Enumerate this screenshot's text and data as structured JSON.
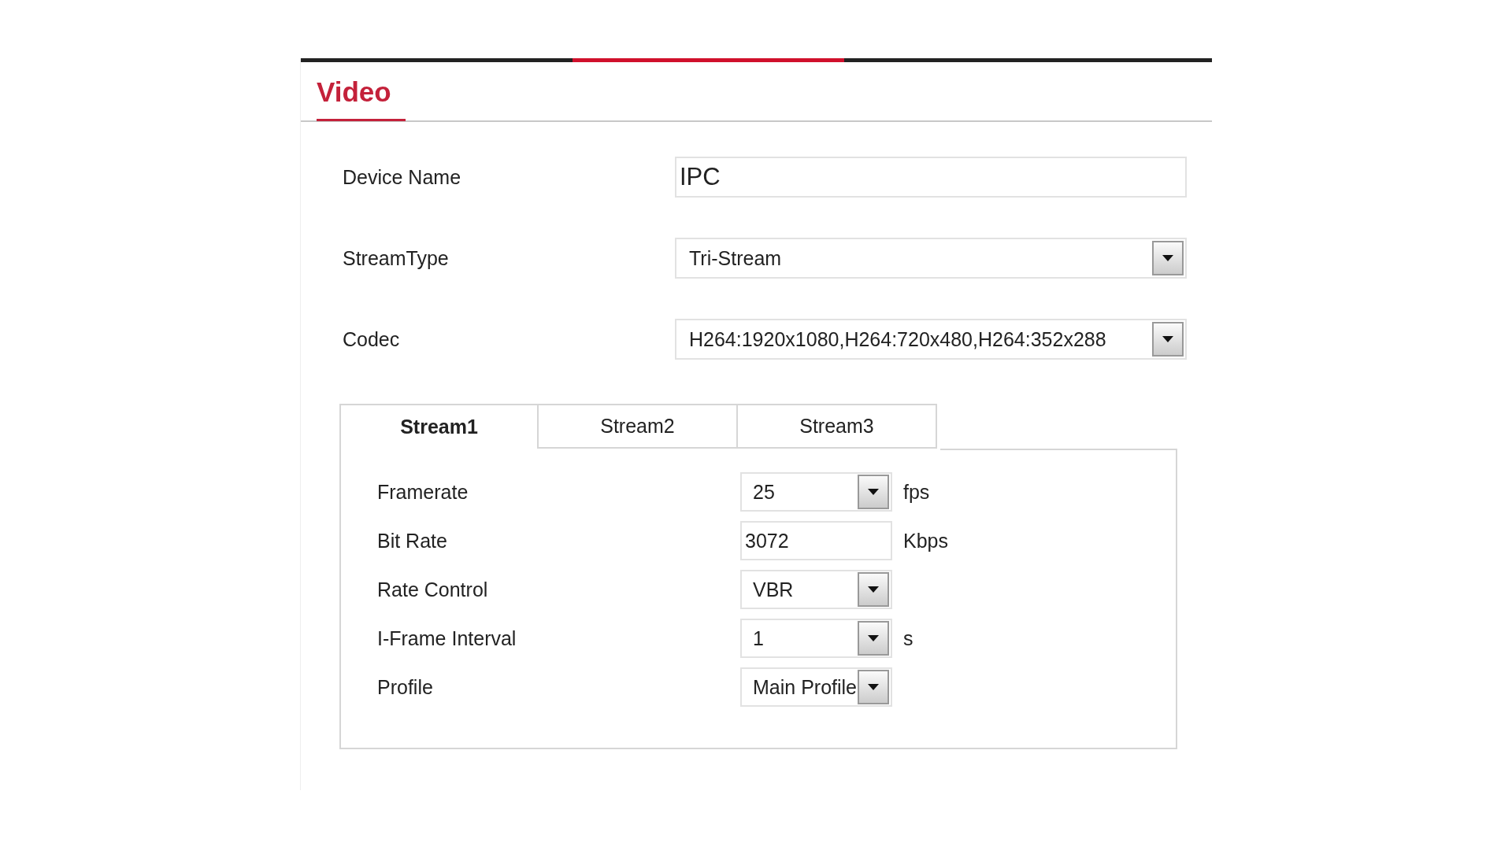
{
  "title": "Video",
  "fields": [
    {
      "label": "Device Name",
      "kind": "input",
      "value": "IPC"
    },
    {
      "label": "StreamType",
      "kind": "select",
      "value": "Tri-Stream"
    },
    {
      "label": "Codec",
      "kind": "select",
      "value": "H264:1920x1080,H264:720x480,H264:352x288"
    }
  ],
  "tabs": [
    {
      "label": "Stream1",
      "selected": true
    },
    {
      "label": "Stream2",
      "selected": false
    },
    {
      "label": "Stream3",
      "selected": false
    }
  ],
  "stream_settings": [
    {
      "label": "Framerate",
      "kind": "select",
      "value": "25",
      "unit": "fps"
    },
    {
      "label": "Bit Rate",
      "kind": "input",
      "value": "3072",
      "unit": "Kbps"
    },
    {
      "label": "Rate Control",
      "kind": "select",
      "value": "VBR"
    },
    {
      "label": "I-Frame Interval",
      "kind": "select",
      "value": "1",
      "unit": "s"
    },
    {
      "label": "Profile",
      "kind": "select",
      "value": "Main Profile"
    }
  ]
}
